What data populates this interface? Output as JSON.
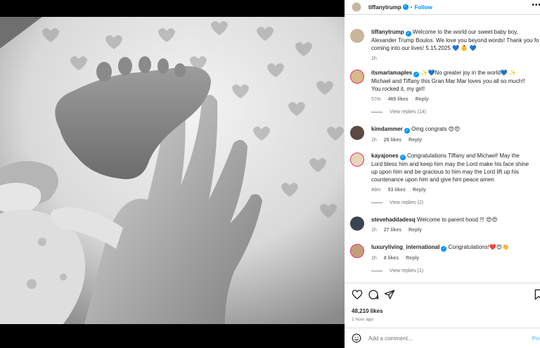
{
  "header": {
    "username": "tiffanytrump",
    "separator": "•",
    "follow_label": "Follow",
    "more_label": "•••"
  },
  "caption": {
    "username": "tiffanytrump",
    "lines": [
      "Welcome to the world our sweet baby boy,",
      "Alexander Trump Boulos. We love you beyond words! Thank you fo",
      "coming into our lives! 5.15.2025 💙 👶 💙"
    ],
    "time": "1h"
  },
  "comments": [
    {
      "username": "itsmarlamaples",
      "lines": [
        "✨💙No greater joy in the world💙 ✨",
        "Michael and Tiffany this Gran Mar Mar loves you all so much!!",
        "You rocked it, my girl!"
      ],
      "time": "57m",
      "likes": "465 likes",
      "reply": "Reply",
      "view_replies": "View replies (14)"
    },
    {
      "username": "kimdammer",
      "lines": [
        "Omg congrats 😍😍"
      ],
      "time": "1h",
      "likes": "29 likes",
      "reply": "Reply"
    },
    {
      "username": "kayajones",
      "lines": [
        "Congratulations Tiffany and Michael! May the",
        "Lord bless him and keep him may the Lord make his face shine",
        "up upon him and be gracious to him may the Lord lift up his",
        "countenance upon him and give him peace amen"
      ],
      "time": "48m",
      "likes": "53 likes",
      "reply": "Reply",
      "view_replies": "View replies (2)"
    },
    {
      "username": "stevehaddadesq",
      "lines": [
        "Welcome to parent hood !!! 😍😍"
      ],
      "time": "1h",
      "likes": "27 likes",
      "reply": "Reply"
    },
    {
      "username": "luxuryliving_international",
      "lines": [
        "Congratulations!❤️😍👏"
      ],
      "time": "1h",
      "likes": "8 likes",
      "reply": "Reply",
      "view_replies": "View replies (1)"
    }
  ],
  "post": {
    "likes": "48,210 likes",
    "time_ago": "1 hour ago"
  },
  "add_comment": {
    "placeholder": "Add a comment...",
    "post_label": "Post"
  },
  "icons": {
    "like": "heart-icon",
    "comment": "comment-icon",
    "share": "share-icon",
    "save": "bookmark-icon",
    "emoji": "emoji-icon",
    "verified": "verified-badge-icon"
  },
  "colors": {
    "link_blue": "#0095f6",
    "verified_blue": "#0095f6",
    "text": "#262626",
    "muted": "#737373"
  }
}
